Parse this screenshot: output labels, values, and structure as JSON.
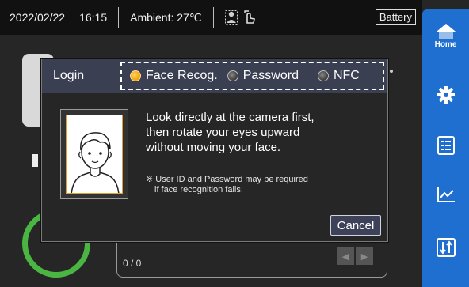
{
  "status_bar": {
    "date": "2022/02/22",
    "time": "16:15",
    "ambient": "Ambient: 27℃",
    "battery_label": "Battery",
    "icons": [
      "user-check-icon",
      "touch-icon"
    ]
  },
  "nav": {
    "home_label": "Home",
    "items": [
      "home-icon",
      "gear-icon",
      "checklist-icon",
      "chart-icon",
      "transfer-icon"
    ],
    "accent": "#1f6fd1"
  },
  "background": {
    "page_count": "0 / 0",
    "ring_color": "#4bb543"
  },
  "dialog": {
    "title": "Login",
    "methods": [
      {
        "label": "Face Recog.",
        "selected": true
      },
      {
        "label": "Password",
        "selected": false
      },
      {
        "label": "NFC",
        "selected": false
      }
    ],
    "instruction_lines": [
      "Look directly at the camera first,",
      "then rotate your eyes upward",
      "without moving your face."
    ],
    "note_lines": [
      "※ User ID and Password may be required",
      "if face recognition fails."
    ],
    "cancel_label": "Cancel",
    "accent_selected": "#f0a000"
  }
}
